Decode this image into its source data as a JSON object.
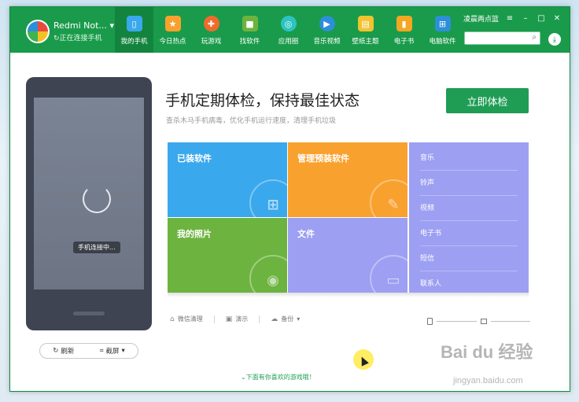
{
  "device": {
    "name": "Redmi Not...",
    "status": "正在连接手机"
  },
  "nav": [
    {
      "label": "我的手机",
      "icon": "phone-icon",
      "color": "#3aa8ec"
    },
    {
      "label": "今日热点",
      "icon": "hot-icon",
      "color": "#f9a12e"
    },
    {
      "label": "玩游戏",
      "icon": "game-icon",
      "color": "#f06b2b"
    },
    {
      "label": "找软件",
      "icon": "software-icon",
      "color": "#6db33f"
    },
    {
      "label": "应用圈",
      "icon": "circle-icon",
      "color": "#2cc3c1"
    },
    {
      "label": "音乐视频",
      "icon": "play-icon",
      "color": "#2d8fd8"
    },
    {
      "label": "壁纸主题",
      "icon": "wallpaper-icon",
      "color": "#f2c230"
    },
    {
      "label": "电子书",
      "icon": "book-icon",
      "color": "#f5a623"
    },
    {
      "label": "电脑软件",
      "icon": "windows-icon",
      "color": "#2d8fd8"
    }
  ],
  "window": {
    "login": "凌晨两点篮"
  },
  "search": {
    "placeholder": ""
  },
  "phone": {
    "connecting": "手机连接中...",
    "refresh": "刷新",
    "screenshot": "截屏"
  },
  "main": {
    "headline": "手机定期体检，保持最佳状态",
    "subhead": "查杀木马手机病毒，优化手机运行速度，清理手机垃圾",
    "check_button": "立即体检"
  },
  "tiles": {
    "apps": "已装软件",
    "preinstalled": "管理预装软件",
    "photos": "我的照片",
    "files": "文件"
  },
  "list": [
    "音乐",
    "铃声",
    "视频",
    "电子书",
    "短信",
    "联系人"
  ],
  "tools": {
    "wechat_clean": "微信清理",
    "demo": "演示",
    "backup": "备份"
  },
  "footer": {
    "games": "下面有你喜欢的游戏哦！"
  },
  "watermark": {
    "logo": "Bai du 经验",
    "site": "jingyan.baidu.com"
  }
}
